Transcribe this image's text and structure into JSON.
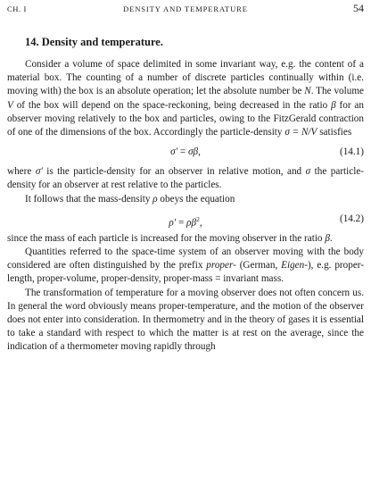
{
  "header": {
    "chapter": "CH. I",
    "running_title": "DENSITY AND TEMPERATURE",
    "page_number": "54"
  },
  "section": {
    "title": "14. Density and temperature."
  },
  "paragraphs": {
    "p1": "Consider a volume of space delimited in some invariant way, e.g. the content of a material box. The counting of a number of discrete particles continually within (i.e. moving with) the box is an absolute operation; let the absolute number be",
    "p1_var_N": "N",
    "p1_b": ". The volume",
    "p1_var_V": "V",
    "p1_c": "of the box will depend on the space-reckoning, being decreased in the ratio",
    "p1_beta": "β",
    "p1_d": "for an observer moving relatively to the box and particles, owing to the FitzGerald contraction of one of the dimensions of the box. Accordingly the particle-density",
    "p1_expr": "σ = N/V",
    "p1_e": "satisfies",
    "p2_a": "where",
    "p2_sigma_prime": "σ′",
    "p2_b": "is the particle-density for an observer in relative motion, and",
    "p2_sigma": "σ",
    "p2_c": "the particle-density for an observer at rest relative to the particles.",
    "p3_a": "It follows that the mass-density",
    "p3_rho": "ρ",
    "p3_b": "obeys the equation",
    "p4_a": "since the mass of each particle is increased for the moving observer in the ratio",
    "p4_beta": "β",
    "p4_b": ".",
    "p5_a": "Quantities referred to the space-time system of an observer moving with the body considered are often distinguished by the prefix",
    "p5_proper": "proper-",
    "p5_b": "(German,",
    "p5_eigen": "Eigen-",
    "p5_c": "), e.g. proper-length, proper-volume, proper-density, proper-mass = invariant mass.",
    "p6": "The transformation of temperature for a moving observer does not often concern us. In general the word obviously means proper-temperature, and the motion of the observer does not enter into consideration. In thermometry and in the theory of gases it is essential to take a standard with respect to which the matter is at rest on the average, since the indication of a thermometer moving rapidly through"
  },
  "equations": {
    "eq1": {
      "lhs": "σ′",
      "op": "=",
      "rhs": "σβ,",
      "number": "(14.1)"
    },
    "eq2": {
      "lhs": "ρ′",
      "op": "=",
      "rhs": "ρβ",
      "sup": "2",
      "tail": ",",
      "number": "(14.2)"
    }
  }
}
